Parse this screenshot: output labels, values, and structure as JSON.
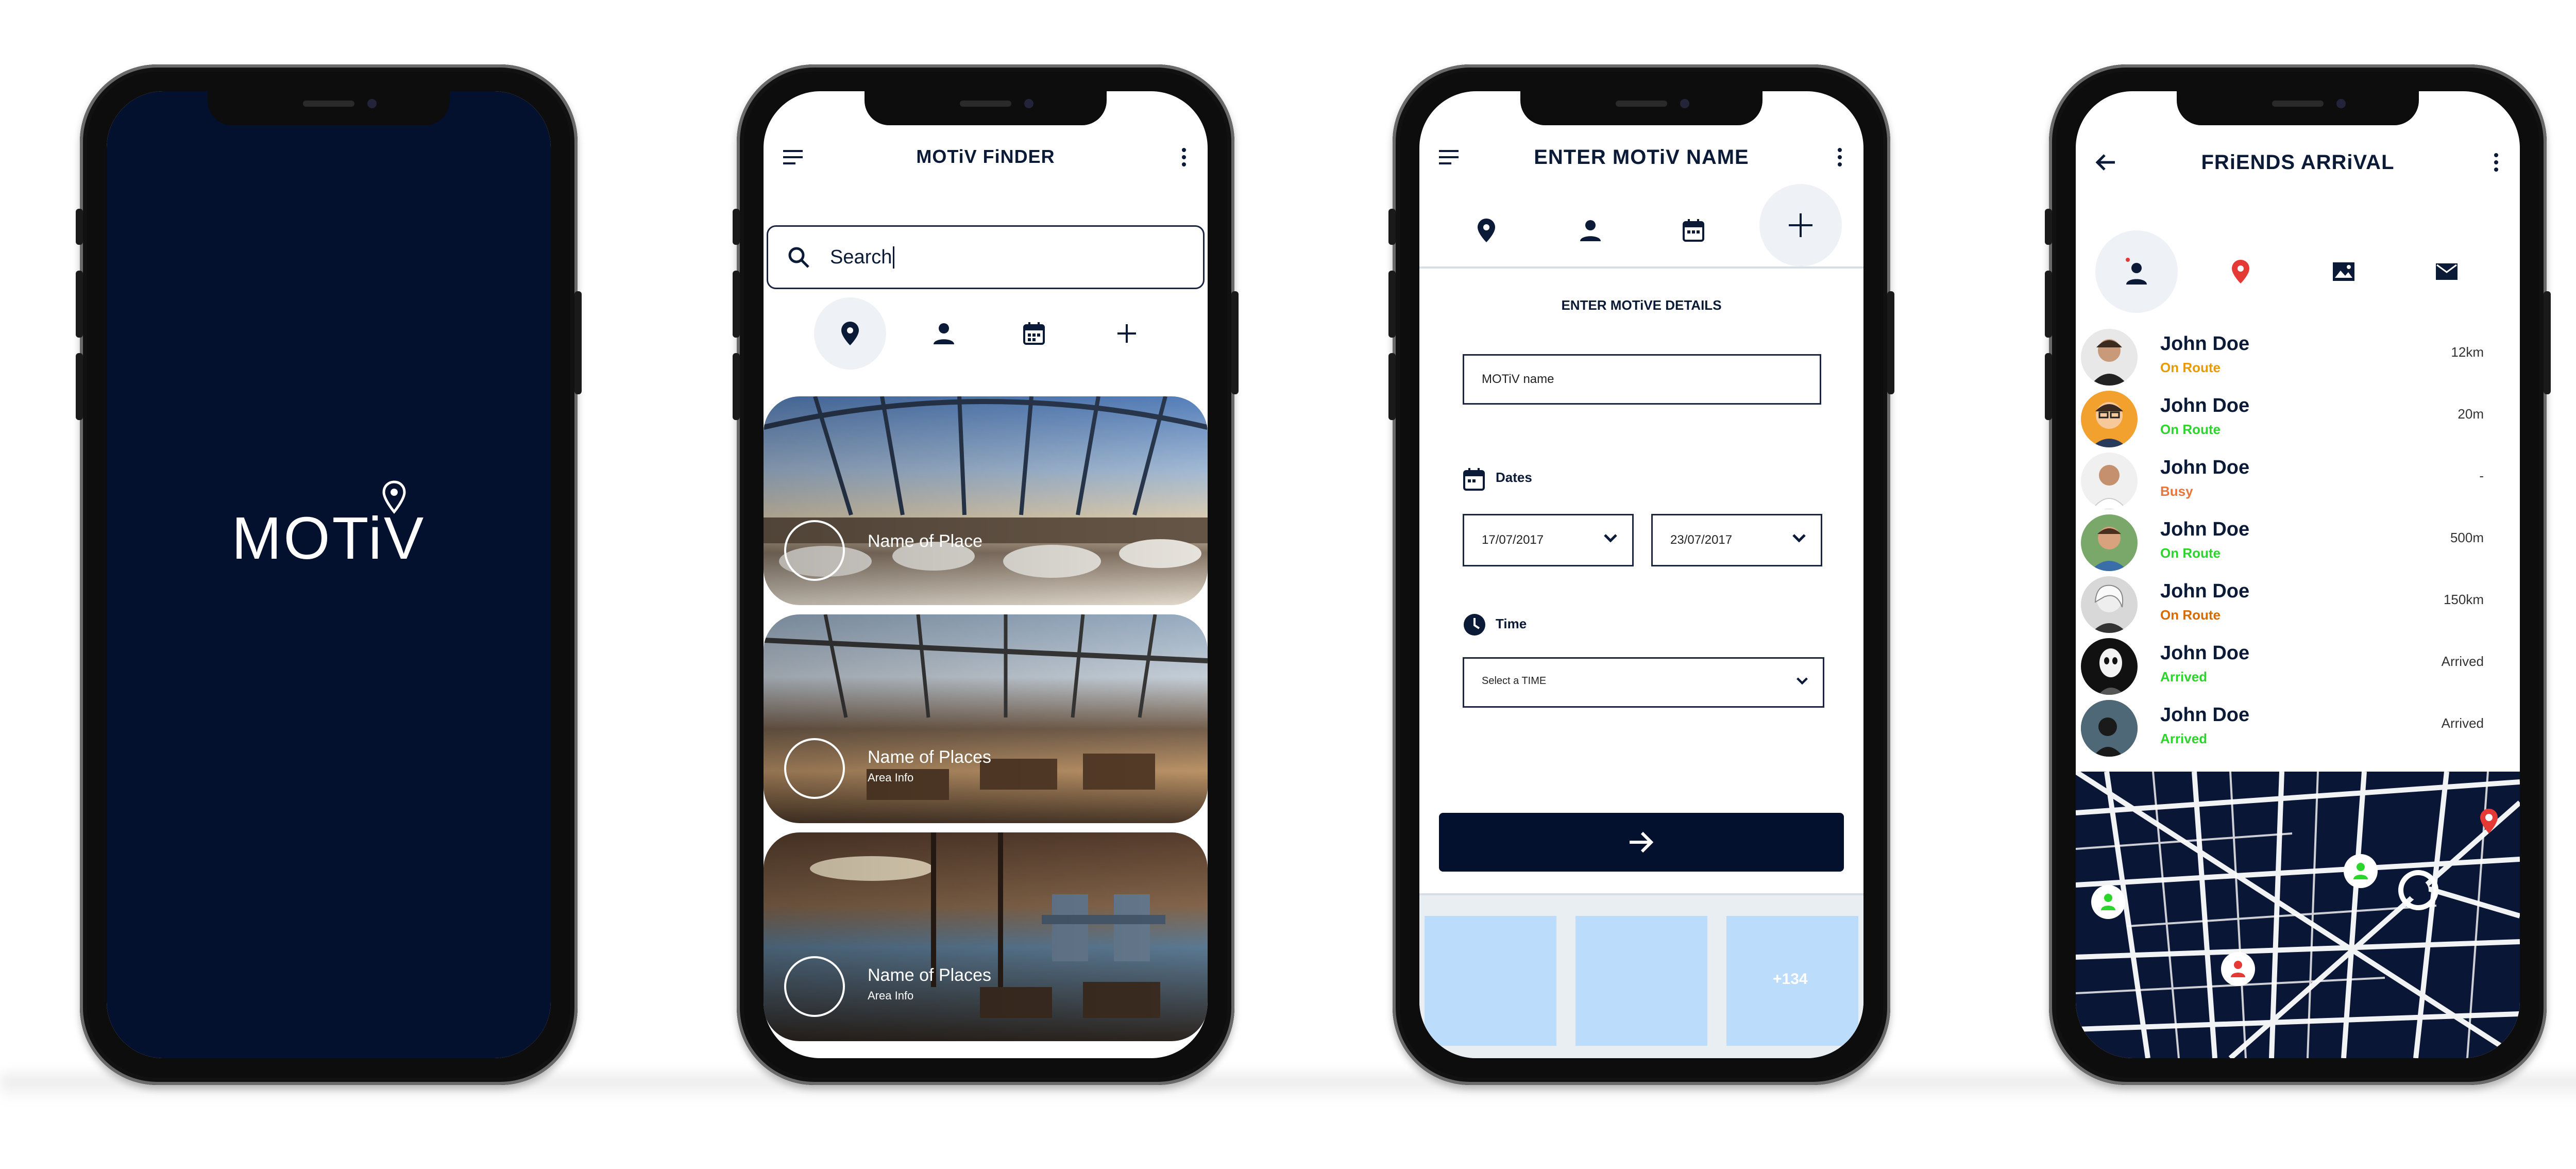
{
  "brand": {
    "logo_text": "MOTiV"
  },
  "finder": {
    "title": "MOTiV FiNDER",
    "search_text": "Search",
    "tabs": [
      "location",
      "person",
      "calendar",
      "add"
    ],
    "places": [
      {
        "name": "Name of Place",
        "area": ""
      },
      {
        "name": "Name of Places",
        "area": "Area Info"
      },
      {
        "name": "Name of Places",
        "area": "Area Info"
      }
    ]
  },
  "create": {
    "title": "ENTER MOTiV NAME",
    "section_title": "ENTER MOTiVE DETAILS",
    "name_value": "MOTiV name",
    "dates_label": "Dates",
    "date_from": "17/07/2017",
    "date_to": "23/07/2017",
    "time_label": "Time",
    "time_placeholder": "Select a TIME",
    "gallery_more": "+134"
  },
  "arrival": {
    "title": "FRiENDS ARRiVAL",
    "friends": [
      {
        "name": "John Doe",
        "status": "On Route",
        "status_color": "#e89a00",
        "distance": "12km"
      },
      {
        "name": "John Doe",
        "status": "On Route",
        "status_color": "#2bd52b",
        "distance": "20m"
      },
      {
        "name": "John Doe",
        "status": "Busy",
        "status_color": "#e8753a",
        "distance": "-"
      },
      {
        "name": "John Doe",
        "status": "On Route",
        "status_color": "#2bd52b",
        "distance": "500m"
      },
      {
        "name": "John Doe",
        "status": "On Route",
        "status_color": "#d86a00",
        "distance": "150km"
      },
      {
        "name": "John Doe",
        "status": "Arrived",
        "status_color": "#2bd52b",
        "distance": "Arrived"
      },
      {
        "name": "John Doe",
        "status": "Arrived",
        "status_color": "#2bd52b",
        "distance": "Arrived"
      }
    ]
  },
  "colors": {
    "navy": "#03102e",
    "light_blue": "#bcdcfb",
    "map_pin_red": "#e53935",
    "map_pin_green": "#2bd52b"
  }
}
